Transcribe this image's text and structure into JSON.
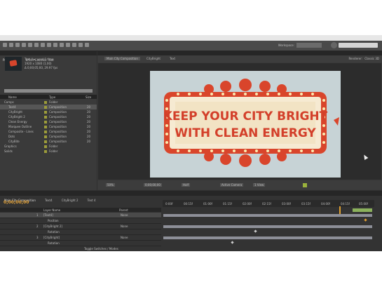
{
  "menu": [
    "File",
    "Edit",
    "Composition",
    "Layer",
    "Effect",
    "Animation",
    "View",
    "Window",
    "Help"
  ],
  "toolbar": {
    "workspace_label": "Workspace:",
    "workspace_value": "Standard",
    "search_placeholder": "Search Help"
  },
  "project": {
    "tab_label": "Project",
    "tab2_label": "Effect Controls: Text",
    "selected_name": "Text 4 ▾, used 1 time",
    "selected_info": "1920 x 1080 (1.00)",
    "selected_info2": "Δ 0;00;05;00, 29.97 fps",
    "col_name": "Name",
    "col_type": "Type",
    "col_size": "Size",
    "items": [
      {
        "name": "Comps",
        "type": "Folder",
        "size": ""
      },
      {
        "name": "Text4",
        "type": "Composition",
        "size": "20"
      },
      {
        "name": "CityBright",
        "type": "Composition",
        "size": "20"
      },
      {
        "name": "CityBright 2",
        "type": "Composition",
        "size": "20"
      },
      {
        "name": "Clean Energy",
        "type": "Composition",
        "size": "20"
      },
      {
        "name": "Marquee Outline",
        "type": "Composition",
        "size": "20"
      },
      {
        "name": "Composite - Lines",
        "type": "Composition",
        "size": "20"
      },
      {
        "name": "Dots",
        "type": "Composition",
        "size": "20"
      },
      {
        "name": "CityBite",
        "type": "Composition",
        "size": "20"
      },
      {
        "name": "Graphics",
        "type": "Folder",
        "size": ""
      },
      {
        "name": "Solids",
        "type": "Folder",
        "size": ""
      }
    ]
  },
  "composition": {
    "tab_label": "Composition: Main City Composition",
    "crumbs": [
      "Main City Composition",
      "CityBright",
      "Text"
    ],
    "renderer_label": "Renderer:",
    "renderer_value": "Classic 3D",
    "sign_line1": "KEEP YOUR CITY BRIGHT",
    "sign_line2": "WITH CLEAN ENERGY",
    "zoom": "50%",
    "timecode": "0;00;00;00",
    "resolution": "Half",
    "camera": "Active Camera",
    "views": "1 View"
  },
  "timeline": {
    "tabs": [
      "Main City Composition",
      "Text4",
      "CityBright 2",
      "Text 4"
    ],
    "timecode": "0;00;00;00",
    "col_layer": "Layer Name",
    "col_parent": "Parent",
    "layers": [
      {
        "num": "1",
        "name": "[Text4]",
        "parent": "None"
      },
      {
        "num": "",
        "name": "Position",
        "parent": ""
      },
      {
        "num": "2",
        "name": "[CityBright 2]",
        "parent": "None"
      },
      {
        "num": "",
        "name": "Rotation",
        "parent": ""
      },
      {
        "num": "3",
        "name": "[CityBright]",
        "parent": "None"
      },
      {
        "num": "",
        "name": "Rotation",
        "parent": ""
      }
    ],
    "ruler": [
      "0:00f",
      "00:15f",
      "01:00f",
      "01:15f",
      "02:00f",
      "02:15f",
      "03:00f",
      "03:15f",
      "04:00f",
      "04:15f",
      "05:00f"
    ],
    "footer": "Toggle Switches / Modes"
  }
}
